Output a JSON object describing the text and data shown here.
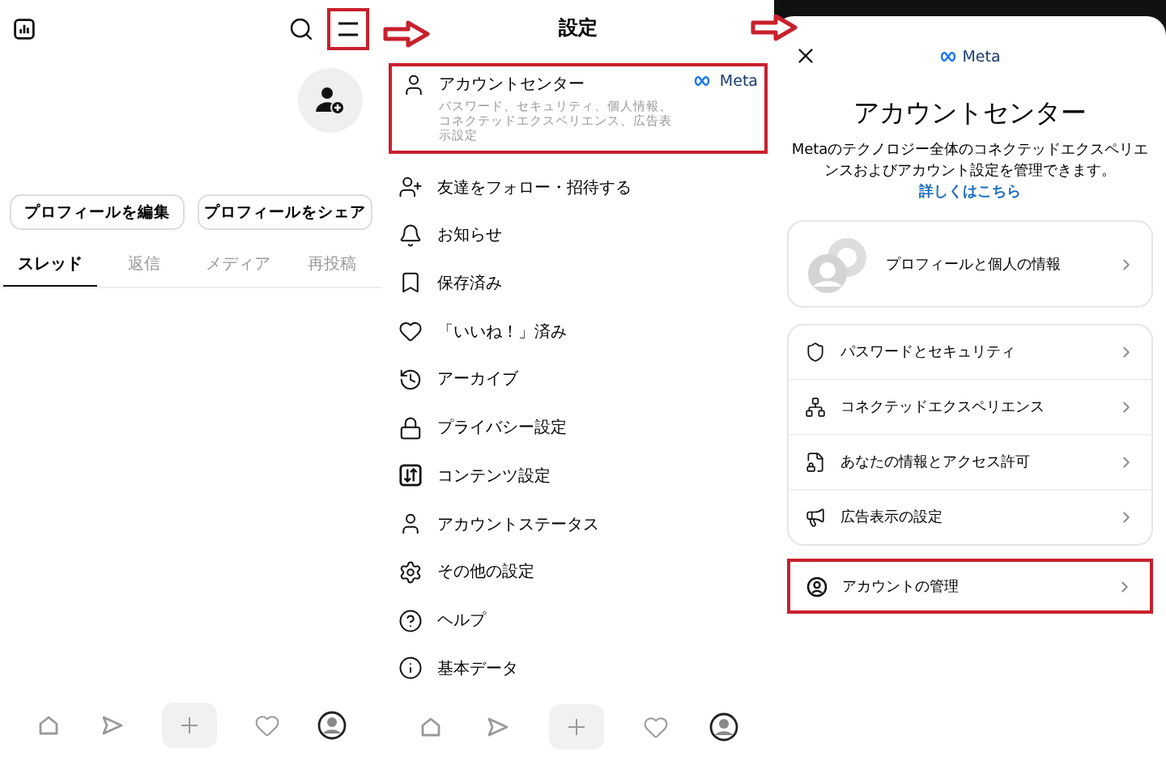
{
  "profile": {
    "menu_highlighted": true,
    "buttons": [
      "プロフィールを編集",
      "プロフィールをシェア"
    ],
    "tabs": [
      {
        "label": "スレッド",
        "selected": true
      },
      {
        "label": "返信",
        "selected": false
      },
      {
        "label": "メディア",
        "selected": false
      },
      {
        "label": "再投稿",
        "selected": false
      }
    ]
  },
  "settings": {
    "title": "設定",
    "account_center": {
      "title": "アカウントセンター",
      "subtitle": "パスワード、セキュリティ、個人情報、コネクテッドエクスペリエンス、広告表示設定",
      "brand": "Meta",
      "highlighted": true
    },
    "items": [
      {
        "kind": "follow",
        "label": "友達をフォロー・招待する"
      },
      {
        "kind": "bell",
        "label": "お知らせ"
      },
      {
        "kind": "bookmark",
        "label": "保存済み"
      },
      {
        "kind": "heart",
        "label": "「いいね！」済み"
      },
      {
        "kind": "history",
        "label": "アーカイブ"
      },
      {
        "kind": "lock",
        "label": "プライバシー設定"
      },
      {
        "kind": "content",
        "label": "コンテンツ設定"
      },
      {
        "kind": "person",
        "label": "アカウントステータス"
      },
      {
        "kind": "gear",
        "label": "その他の設定"
      },
      {
        "kind": "help",
        "label": "ヘルプ"
      },
      {
        "kind": "info",
        "label": "基本データ"
      }
    ]
  },
  "account_center": {
    "brand": "Meta",
    "title": "アカウントセンター",
    "description": "Metaのテクノロジー全体のコネクテッドエクスペリエンスおよびアカウント設定を管理できます。",
    "link": "詳しくはこちら",
    "profile_card": "プロフィールと個人の情報",
    "items": [
      {
        "kind": "shield",
        "label": "パスワードとセキュリティ"
      },
      {
        "kind": "network",
        "label": "コネクテッドエクスペリエンス"
      },
      {
        "kind": "file",
        "label": "あなたの情報とアクセス許可"
      },
      {
        "kind": "megaphone",
        "label": "広告表示の設定"
      }
    ],
    "manage": {
      "label": "アカウントの管理",
      "highlighted": true
    }
  }
}
